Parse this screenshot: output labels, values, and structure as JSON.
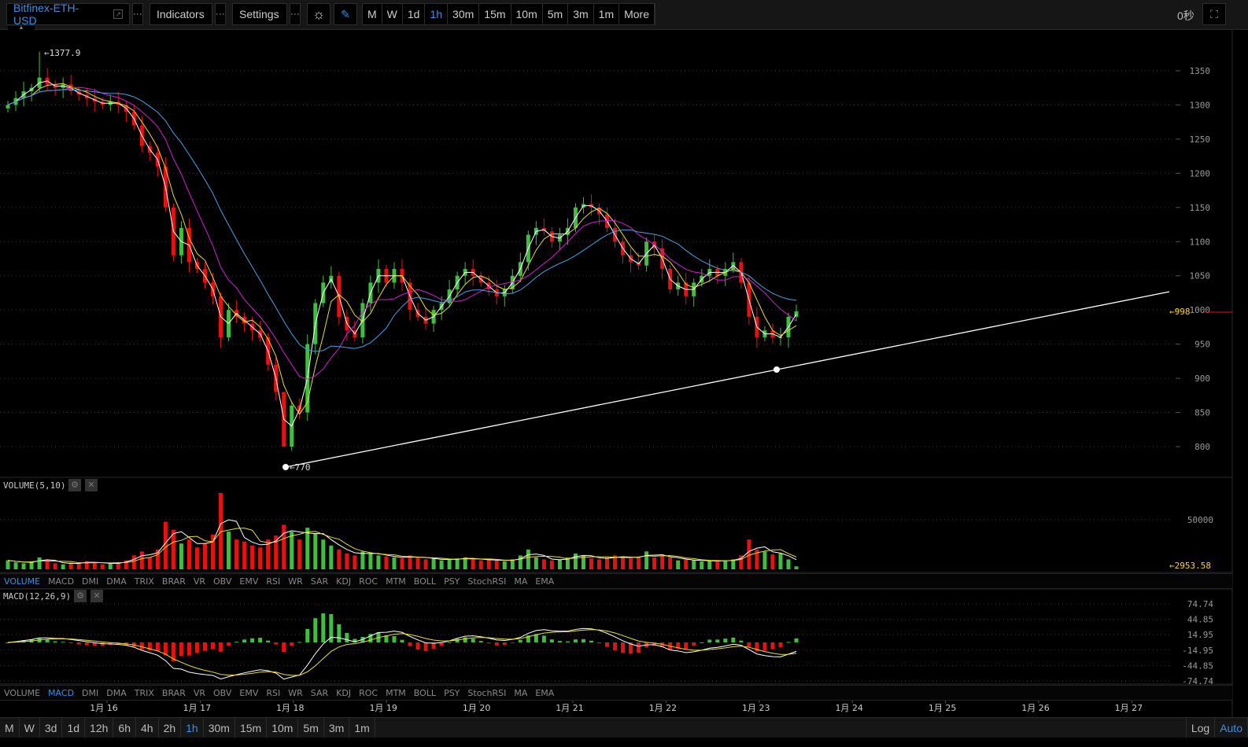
{
  "toolbar": {
    "symbol": "Bitfinex-ETH-USD",
    "indicators": "Indicators",
    "settings": "Settings",
    "periods": [
      "M",
      "W",
      "1d",
      "1h",
      "30m",
      "15m",
      "10m",
      "5m",
      "3m",
      "1m",
      "More"
    ],
    "active_period": "1h",
    "timer": "0秒"
  },
  "price_axis": {
    "ticks": [
      "1350",
      "1300",
      "1250",
      "1200",
      "1150",
      "1100",
      "1050",
      "1000",
      "950",
      "900",
      "850",
      "800"
    ],
    "current": "←998",
    "high_label": "←1377.9",
    "low_label": "←770"
  },
  "volume": {
    "title": "VOLUME(5,10)",
    "tick": "50000",
    "current": "←2953.58"
  },
  "macd": {
    "title": "MACD(12,26,9)",
    "ticks": [
      "74.74",
      "44.85",
      "14.95",
      "-14.95",
      "-44.85",
      "-74.74"
    ]
  },
  "indicator_tabs": [
    "VOLUME",
    "MACD",
    "DMI",
    "DMA",
    "TRIX",
    "BRAR",
    "VR",
    "OBV",
    "EMV",
    "RSI",
    "WR",
    "SAR",
    "KDJ",
    "ROC",
    "MTM",
    "BOLL",
    "PSY",
    "StochRSI",
    "MA",
    "EMA"
  ],
  "time_axis": [
    "1月 16",
    "1月 17",
    "1月 18",
    "1月 19",
    "1月 20",
    "1月 21",
    "1月 22",
    "1月 23",
    "1月 24",
    "1月 25",
    "1月 26",
    "1月 27"
  ],
  "bottom_periods": [
    "M",
    "W",
    "3d",
    "1d",
    "12h",
    "6h",
    "4h",
    "2h",
    "1h",
    "30m",
    "15m",
    "10m",
    "5m",
    "3m",
    "1m"
  ],
  "bottom_active": "1h",
  "bottom_right": {
    "log": "Log",
    "auto": "Auto"
  },
  "colors": {
    "up": "#3fbf3f",
    "down": "#e81010",
    "accent": "#3a8ee6",
    "ma5": "#ffffff",
    "ma10": "#e8e020",
    "ma20": "#d020d0",
    "ma30": "#4aa0e0"
  },
  "chart_data": {
    "type": "candlestick",
    "interval": "2h",
    "closes": [
      1300,
      1310,
      1320,
      1325,
      1340,
      1330,
      1325,
      1330,
      1320,
      1315,
      1310,
      1305,
      1300,
      1305,
      1300,
      1290,
      1270,
      1240,
      1230,
      1210,
      1150,
      1080,
      1120,
      1070,
      1060,
      1040,
      1020,
      960,
      1000,
      990,
      980,
      970,
      960,
      920,
      880,
      800,
      860,
      850,
      950,
      1010,
      1040,
      1050,
      990,
      970,
      960,
      1010,
      1040,
      1060,
      1040,
      1060,
      1040,
      1000,
      990,
      980,
      1000,
      1010,
      1030,
      1050,
      1060,
      1050,
      1040,
      1030,
      1020,
      1030,
      1050,
      1070,
      1110,
      1120,
      1115,
      1100,
      1110,
      1120,
      1150,
      1155,
      1150,
      1140,
      1120,
      1100,
      1080,
      1070,
      1065,
      1100,
      1090,
      1060,
      1030,
      1040,
      1020,
      1040,
      1050,
      1060,
      1050,
      1060,
      1070,
      1040,
      990,
      960,
      970,
      960,
      960,
      990,
      998
    ],
    "volumes": [
      9000,
      7000,
      6000,
      8000,
      12000,
      9000,
      6000,
      5000,
      7000,
      6000,
      8000,
      7000,
      5000,
      6000,
      7000,
      9000,
      14000,
      18000,
      12000,
      20000,
      48000,
      40000,
      26000,
      30000,
      22000,
      26000,
      35000,
      77000,
      38000,
      30000,
      28000,
      24000,
      22000,
      30000,
      34000,
      45000,
      38000,
      30000,
      42000,
      36000,
      30000,
      24000,
      20000,
      16000,
      14000,
      18000,
      16000,
      14000,
      13000,
      12000,
      11000,
      14000,
      12000,
      10000,
      11000,
      9000,
      10000,
      11000,
      12000,
      10000,
      9000,
      10000,
      9000,
      8000,
      10000,
      14000,
      20000,
      12000,
      10000,
      9000,
      10000,
      12000,
      16000,
      14000,
      11000,
      10000,
      12000,
      14000,
      12000,
      11000,
      13000,
      18000,
      12000,
      14000,
      12000,
      9000,
      10000,
      9000,
      8000,
      9000,
      8000,
      9000,
      10000,
      14000,
      30000,
      20000,
      18000,
      15000,
      16000,
      10000,
      2953.58
    ],
    "ylim": [
      780,
      1380
    ],
    "trendline": {
      "from": 770,
      "to": 1025
    }
  }
}
